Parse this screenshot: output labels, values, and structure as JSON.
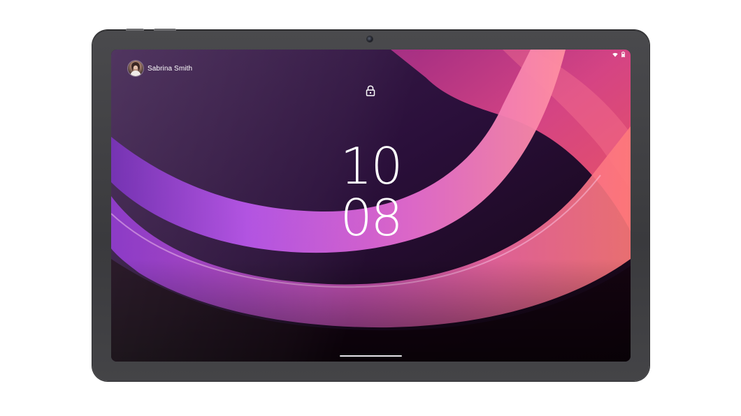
{
  "lock_screen": {
    "user": {
      "name": "Sabrina Smith",
      "avatar_icon": "user-avatar"
    },
    "status_icons": [
      "wifi-icon",
      "battery-icon"
    ],
    "lock_icon": "lock-icon",
    "clock": {
      "hours": "10",
      "minutes": "08"
    }
  },
  "colors": {
    "bezel": "#3f3f42",
    "wallpaper_dark": "#241033",
    "wallpaper_purple": "#9a2fd6",
    "wallpaper_pink": "#f06aa8",
    "wallpaper_coral": "#ff6f7d"
  }
}
